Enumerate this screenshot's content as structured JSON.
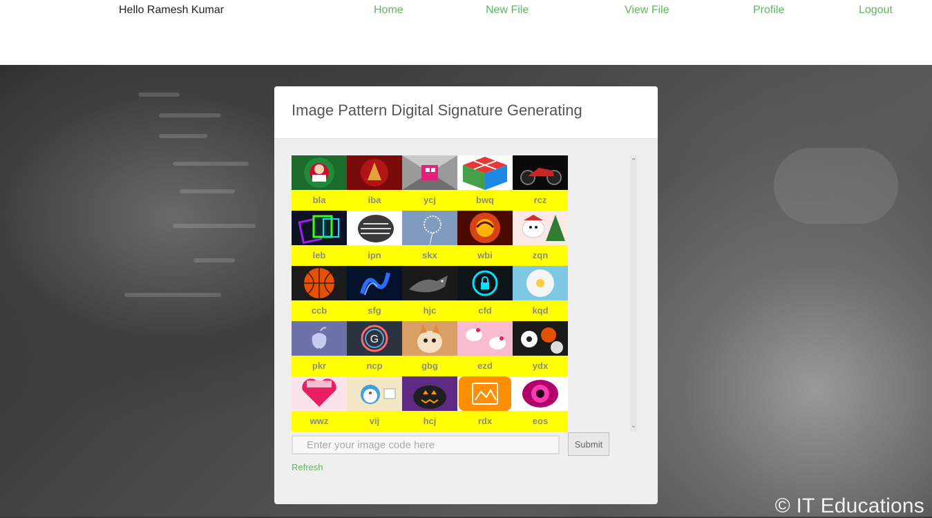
{
  "nav": {
    "greeting": "Hello Ramesh Kumar",
    "links": [
      "Home",
      "New File",
      "View File",
      "Profile",
      "Logout"
    ],
    "link_color": "#5cb85c"
  },
  "panel": {
    "title": "Image Pattern Digital Signature Generating",
    "codes": [
      [
        "bla",
        "iba",
        "ycj",
        "bwq",
        "rcz"
      ],
      [
        "leb",
        "ipn",
        "skx",
        "wbi",
        "zqn"
      ],
      [
        "ccb",
        "sfg",
        "hjc",
        "cfd",
        "kqd"
      ],
      [
        "pkr",
        "ncp",
        "gbg",
        "ezd",
        "ydx"
      ],
      [
        "wwz",
        "vij",
        "hcj",
        "rdx",
        "eos"
      ]
    ],
    "images": [
      [
        "santa-wreath-image",
        "liverpool-crest-image",
        "pink-cube-image",
        "rubiks-cube-image",
        "red-motorcycle-image"
      ],
      [
        "neon-cards-image",
        "football-helmet-image",
        "dandelion-image",
        "fire-dragon-image",
        "hello-kitty-christmas-image"
      ],
      [
        "basketball-image",
        "blue-dragon-image",
        "wolf-image",
        "lock-icon-image",
        "white-flower-image"
      ],
      [
        "apple-logo-image",
        "google-g-image",
        "kitten-image",
        "hello-kitty-pattern-image",
        "sports-balls-image"
      ],
      [
        "pink-heart-image",
        "doraemon-image",
        "pumpkin-image",
        "orange-app-image",
        "pink-eye-image"
      ]
    ],
    "label_bg": "#ffff00",
    "input_placeholder": "Enter your image code here",
    "submit_label": "Submit",
    "refresh_label": "Refresh"
  },
  "footer": {
    "watermark": "© IT Educations"
  }
}
